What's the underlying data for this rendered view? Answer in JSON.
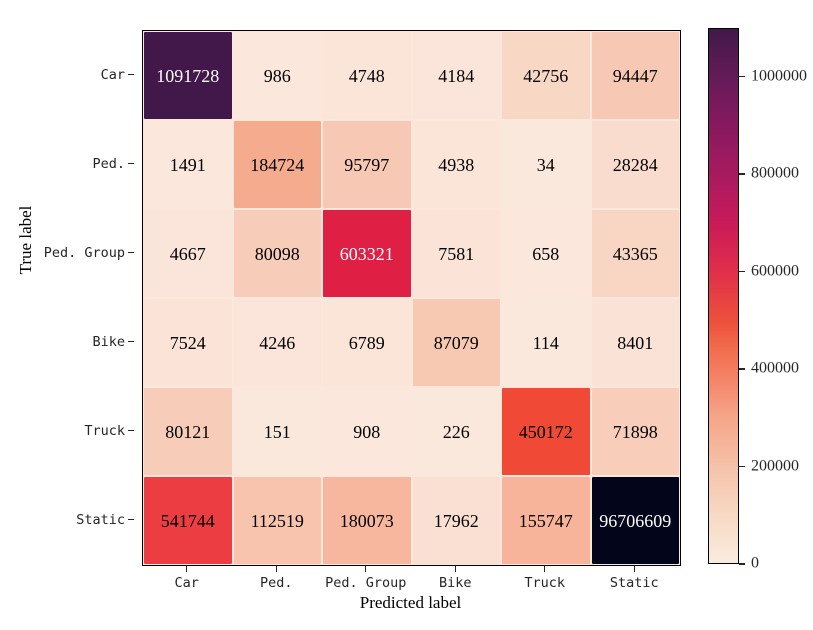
{
  "chart_data": {
    "type": "heatmap",
    "title": "",
    "xlabel": "Predicted label",
    "ylabel": "True label",
    "categories_x": [
      "Car",
      "Ped.",
      "Ped. Group",
      "Bike",
      "Truck",
      "Static"
    ],
    "categories_y": [
      "Car",
      "Ped.",
      "Ped. Group",
      "Bike",
      "Truck",
      "Static"
    ],
    "colorbar": {
      "min": 0,
      "max": 1100000,
      "ticks": [
        0,
        200000,
        400000,
        600000,
        800000,
        1000000
      ],
      "tick_labels": [
        "0",
        "200000",
        "400000",
        "600000",
        "800000",
        "1000000"
      ],
      "position": "right",
      "colormap": "rocket_r"
    },
    "rows": [
      {
        "label": "Car",
        "values": [
          1091728,
          986,
          4748,
          4184,
          42756,
          94447
        ],
        "colors": [
          "#42184a",
          "#fbe7dc",
          "#fbe5d9",
          "#fbe5da",
          "#f9d7c5",
          "#f7c9b4"
        ],
        "text_colors": [
          "#ffffff",
          "#000000",
          "#000000",
          "#000000",
          "#000000",
          "#000000"
        ]
      },
      {
        "label": "Ped.",
        "values": [
          1491,
          184724,
          95797,
          4938,
          34,
          28284
        ],
        "colors": [
          "#fbe7dc",
          "#f5ab8e",
          "#f7c9b4",
          "#fbe5d9",
          "#fbe8dd",
          "#fadcce"
        ],
        "text_colors": [
          "#000000",
          "#000000",
          "#000000",
          "#000000",
          "#000000",
          "#000000"
        ]
      },
      {
        "label": "Ped. Group",
        "values": [
          4667,
          80098,
          603321,
          7581,
          658,
          43365
        ],
        "colors": [
          "#fbe5da",
          "#f7ccb8",
          "#e01f45",
          "#fbe3d7",
          "#fbe7dc",
          "#f9d6c4"
        ],
        "text_colors": [
          "#000000",
          "#000000",
          "#ffffff",
          "#000000",
          "#000000",
          "#000000"
        ]
      },
      {
        "label": "Bike",
        "values": [
          7524,
          4246,
          6789,
          87079,
          114,
          8401
        ],
        "colors": [
          "#fbe3d7",
          "#fbe5da",
          "#fbe4d8",
          "#f7c8b2",
          "#fbe8dd",
          "#fbe2d6"
        ],
        "text_colors": [
          "#000000",
          "#000000",
          "#000000",
          "#000000",
          "#000000",
          "#000000"
        ]
      },
      {
        "label": "Truck",
        "values": [
          80121,
          151,
          908,
          226,
          450172,
          71898
        ],
        "colors": [
          "#f7ccb8",
          "#fbe8dd",
          "#fbe7dc",
          "#fbe8dc",
          "#f04a36",
          "#f8cebb"
        ],
        "text_colors": [
          "#000000",
          "#000000",
          "#000000",
          "#000000",
          "#000000",
          "#000000"
        ]
      },
      {
        "label": "Static",
        "values": [
          541744,
          112519,
          180073,
          17962,
          155747,
          96706609
        ],
        "colors": [
          "#ec3d42",
          "#f8c4ad",
          "#f6b79e",
          "#fae0d3",
          "#f7b49a",
          "#03061a"
        ],
        "text_colors": [
          "#000000",
          "#000000",
          "#000000",
          "#000000",
          "#000000",
          "#ffffff"
        ]
      }
    ]
  }
}
